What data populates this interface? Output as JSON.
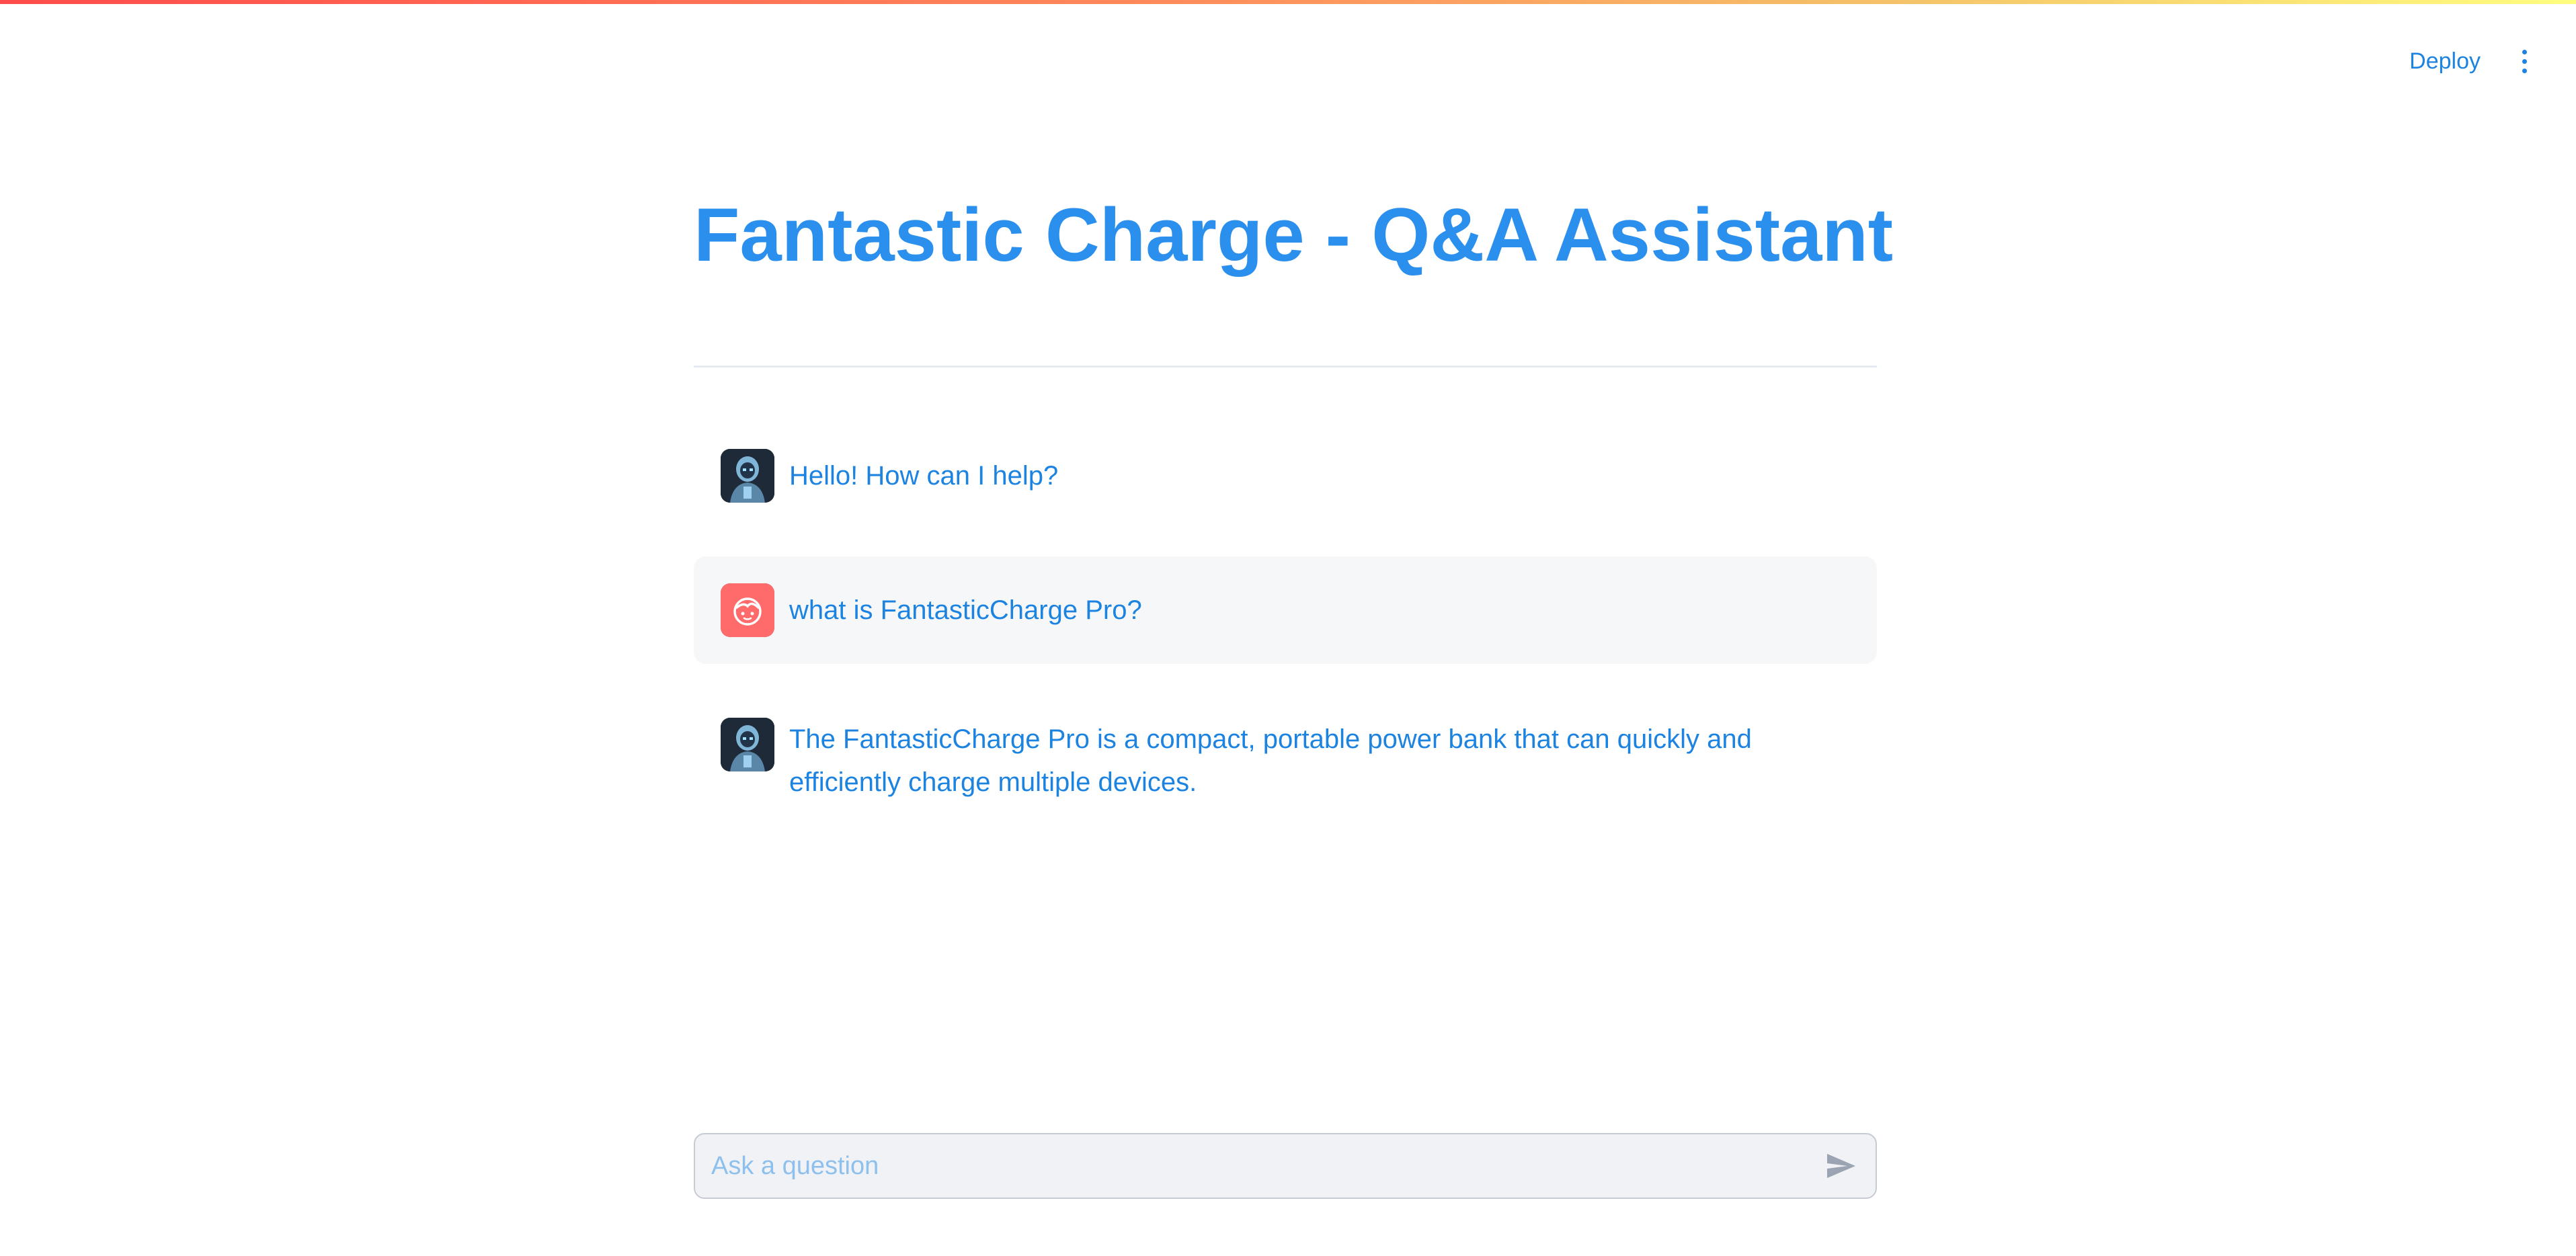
{
  "header": {
    "deploy_label": "Deploy",
    "menu_icon": "kebab-menu-icon"
  },
  "page": {
    "title": "Fantastic Charge - Q&A Assistant"
  },
  "messages": [
    {
      "role": "assistant",
      "avatar": "robot-avatar",
      "text": "Hello! How can I help?"
    },
    {
      "role": "user",
      "avatar": "user-face-avatar",
      "text": "what is FantasticCharge Pro?"
    },
    {
      "role": "assistant",
      "avatar": "robot-avatar",
      "text": "The FantasticCharge Pro is a compact, portable power bank that can quickly and efficiently charge multiple devices."
    }
  ],
  "chat_input": {
    "placeholder": "Ask a question",
    "value": "",
    "send_icon": "send-icon"
  },
  "colors": {
    "accent": "#1c83e1",
    "title": "#2b8fed",
    "user_avatar": "#ff6b6b",
    "input_bg": "#f0f2f6"
  }
}
